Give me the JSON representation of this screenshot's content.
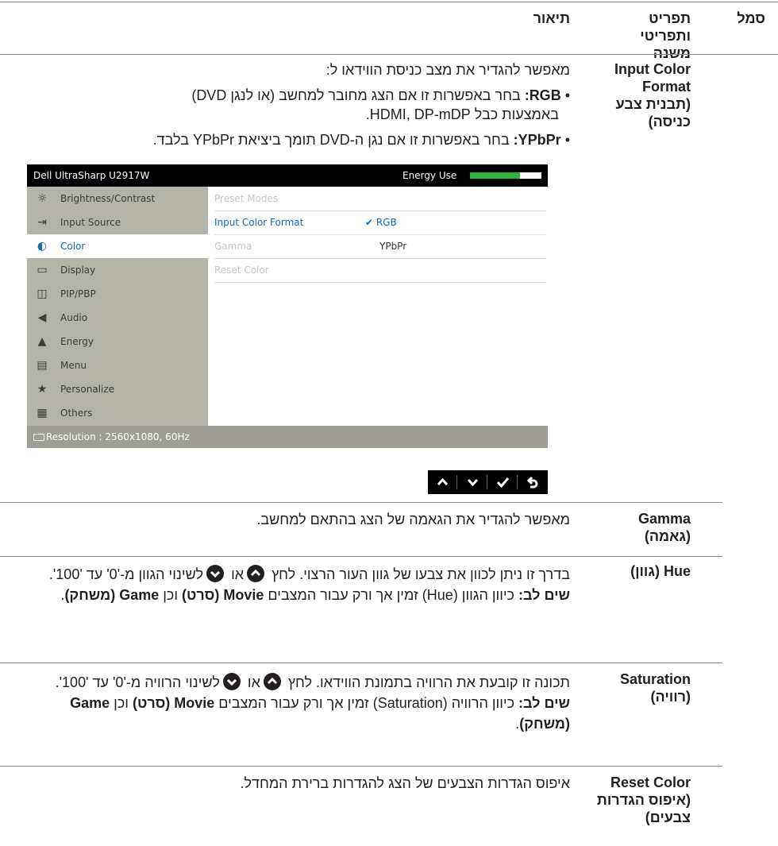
{
  "headers": {
    "symbol": "סמל",
    "feature": "תפריט ותפריטי משנה",
    "description": "תיאור"
  },
  "rows": {
    "input_color_format": {
      "feature_lines": [
        "Input Color",
        "Format",
        "(תבנית צבע",
        "כניסה)"
      ],
      "intro": "מאפשר להגדיר את מצב כניסת הווידאו ל:",
      "rgb_term": "RGB:",
      "rgb_text_1": " בחר באפשרות זו אם הצג מחובר למחשב (או לנגן DVD)",
      "rgb_text_2": "באמצעות כבל HDMI, DP-mDP.",
      "ypbpr_term": "YPbPr:",
      "ypbpr_text": " בחר באפשרות זו אם נגן ה-DVD תומך ביציאת YPbPr בלבד."
    },
    "gamma": {
      "feature_lines": [
        "Gamma",
        "(גאמה)"
      ],
      "text": "מאפשר להגדיר את הגאמה של הצג בהתאם למחשב."
    },
    "hue": {
      "feature_lines": [
        "Hue (גוון)"
      ],
      "text_1": "בדרך זו ניתן לכוון את צבעו של גוון העור הרצוי. לחץ",
      "or": "או",
      "text_2": "לשינוי הגוון מ-'0' עד '100'.",
      "note_term": "שים לב:",
      "note_text_1": " כיוון הגוון (Hue) זמין אך ורק עבור המצבים ",
      "note_movie": "Movie (סרט)",
      "note_and": " וכן ",
      "note_game": "Game (משחק)",
      "note_end": "."
    },
    "saturation": {
      "feature_lines": [
        "Saturation",
        "(רוויה)"
      ],
      "text_1": "תכונה זו קובעת את הרוויה בתמונת הווידאו. לחץ",
      "or": "או",
      "text_2": "לשינוי הרוויה מ-'0' עד '100'.",
      "note_term": "שים לב:",
      "note_text_1": " כיוון הרוויה (Saturation) זמין אך ורק עבור המצבים ",
      "note_movie": "Movie (סרט)",
      "note_and": " וכן ",
      "note_game": "Game (משחק)",
      "note_end": "."
    },
    "reset_color": {
      "feature_lines": [
        "Reset Color",
        "(איפוס הגדרות",
        "צבעים)"
      ],
      "text": "איפוס הגדרות הצבעים של הצג להגדרות ברירת המחדל."
    }
  },
  "osd": {
    "title": "Dell UltraSharp U2917W",
    "energy_label": "Energy Use",
    "energy_level": 0.7,
    "energy_color": "#2bb53c",
    "accent": "#0f6bb8",
    "menu": [
      {
        "label": "Brightness/Contrast",
        "icon": "sun-icon"
      },
      {
        "label": "Input Source",
        "icon": "input-source-icon"
      },
      {
        "label": "Color",
        "icon": "color-icon"
      },
      {
        "label": "Display",
        "icon": "display-icon"
      },
      {
        "label": "PIP/PBP",
        "icon": "pip-icon"
      },
      {
        "label": "Audio",
        "icon": "speaker-icon"
      },
      {
        "label": "Energy",
        "icon": "flame-icon"
      },
      {
        "label": "Menu",
        "icon": "menu-icon"
      },
      {
        "label": "Personalize",
        "icon": "star-icon"
      },
      {
        "label": "Others",
        "icon": "others-icon"
      }
    ],
    "active_menu": "Color",
    "submenu": [
      {
        "label": "Preset Modes"
      },
      {
        "label": "Input Color Format",
        "option": "RGB"
      },
      {
        "label": "Gamma",
        "option": "YPbPr"
      },
      {
        "label": "Reset Color"
      }
    ],
    "status": "Resolution : 2560x1080, 60Hz",
    "buttons": [
      "up-icon",
      "down-icon",
      "check-icon",
      "back-icon"
    ]
  }
}
